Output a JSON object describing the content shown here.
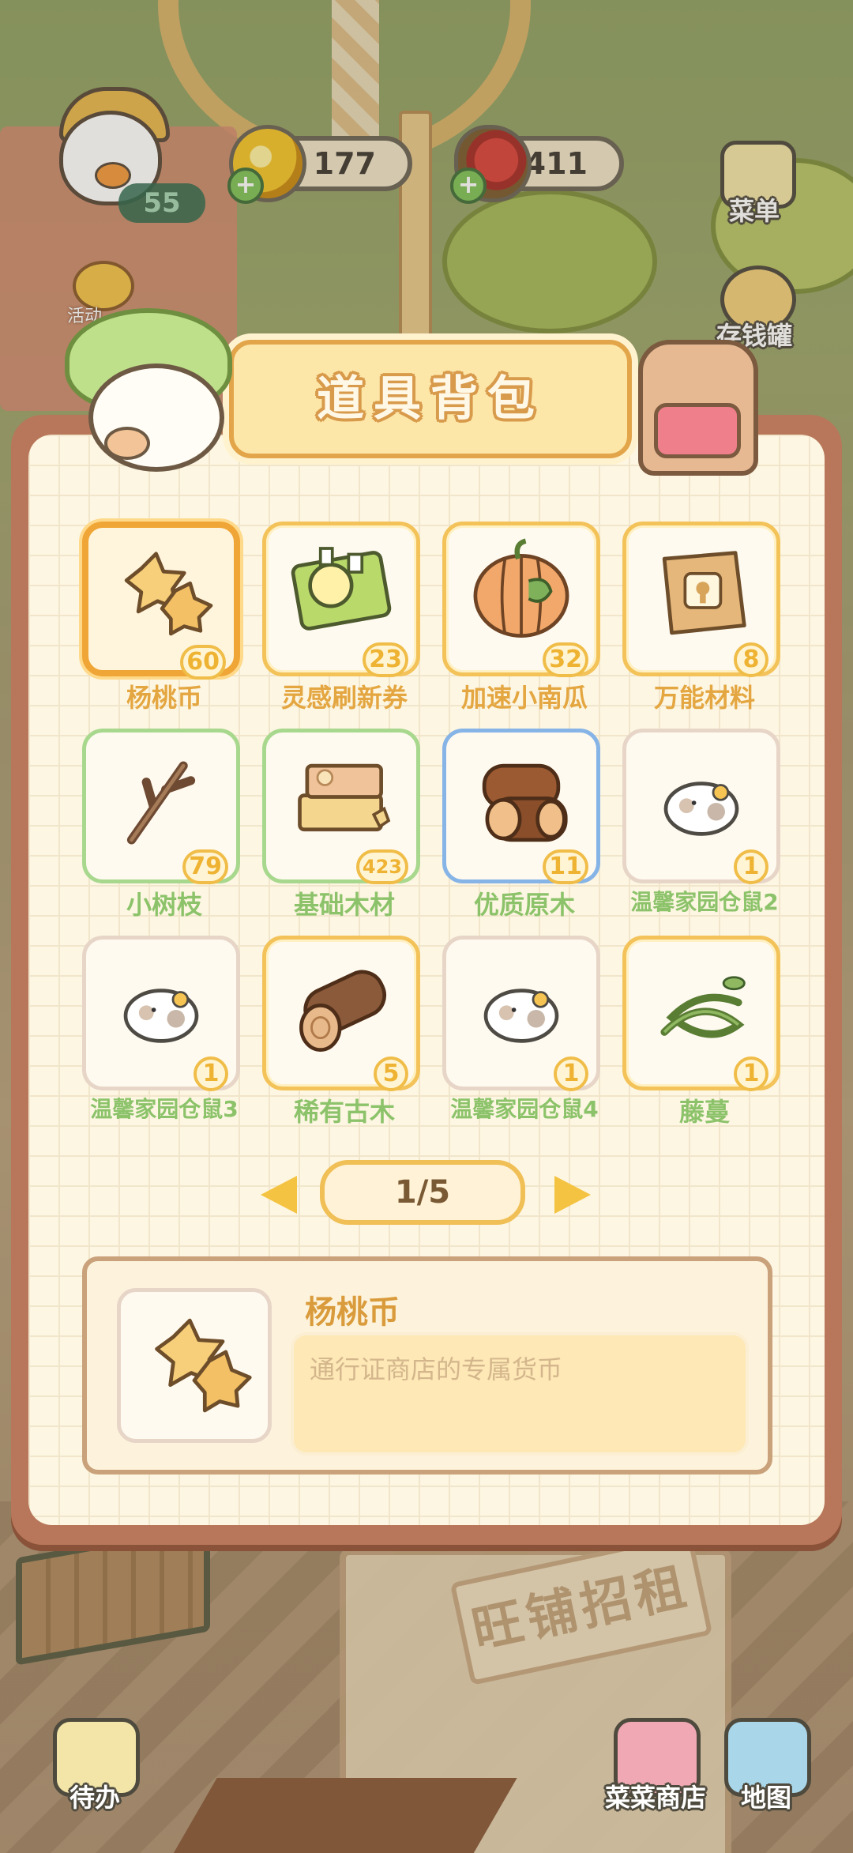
{
  "hud": {
    "level": "55",
    "event_label": "活动",
    "gold_coins": "177",
    "fruit_currency": "7411",
    "side_buttons": [
      {
        "label": "菜单",
        "icon": "menu-tv-icon",
        "color": "#f3e5a8"
      },
      {
        "label": "存钱罐",
        "icon": "piggy-bank-icon",
        "color": "#f2cf7a"
      }
    ]
  },
  "panel": {
    "title": "道具背包"
  },
  "items": [
    {
      "name": "杨桃币",
      "count": "60",
      "frame": "selected",
      "name_color": "gold",
      "icon": "star-fruit-coin-icon"
    },
    {
      "name": "灵感刷新券",
      "count": "23",
      "frame": "gold",
      "name_color": "gold",
      "icon": "inspiration-ticket-icon"
    },
    {
      "name": "加速小南瓜",
      "count": "32",
      "frame": "gold",
      "name_color": "gold",
      "icon": "pumpkin-icon"
    },
    {
      "name": "万能材料",
      "count": "8",
      "frame": "gold",
      "name_color": "gold",
      "icon": "material-bag-icon"
    },
    {
      "name": "小树枝",
      "count": "79",
      "frame": "green",
      "name_color": "green",
      "icon": "twig-icon"
    },
    {
      "name": "基础木材",
      "count": "423",
      "frame": "green",
      "name_color": "green",
      "icon": "wood-plank-icon"
    },
    {
      "name": "优质原木",
      "count": "11",
      "frame": "blue",
      "name_color": "green",
      "icon": "log-icon"
    },
    {
      "name": "温馨家园仓鼠2",
      "count": "1",
      "frame": "plain",
      "name_color": "green",
      "icon": "hamster-icon"
    },
    {
      "name": "温馨家园仓鼠3",
      "count": "1",
      "frame": "plain",
      "name_color": "green",
      "icon": "hamster-icon"
    },
    {
      "name": "稀有古木",
      "count": "5",
      "frame": "gold",
      "name_color": "green",
      "icon": "ancient-log-icon"
    },
    {
      "name": "温馨家园仓鼠4",
      "count": "1",
      "frame": "plain",
      "name_color": "green",
      "icon": "hamster-icon"
    },
    {
      "name": "藤蔓",
      "count": "1",
      "frame": "gold",
      "name_color": "green",
      "icon": "vine-icon"
    }
  ],
  "pager": {
    "current": "1/5"
  },
  "detail": {
    "name": "杨桃币",
    "description": "通行证商店的专属货币"
  },
  "bottom": {
    "todo_label": "待办",
    "shop_label": "菜菜商店",
    "map_label": "地图"
  },
  "background_sign": "旺铺招租"
}
